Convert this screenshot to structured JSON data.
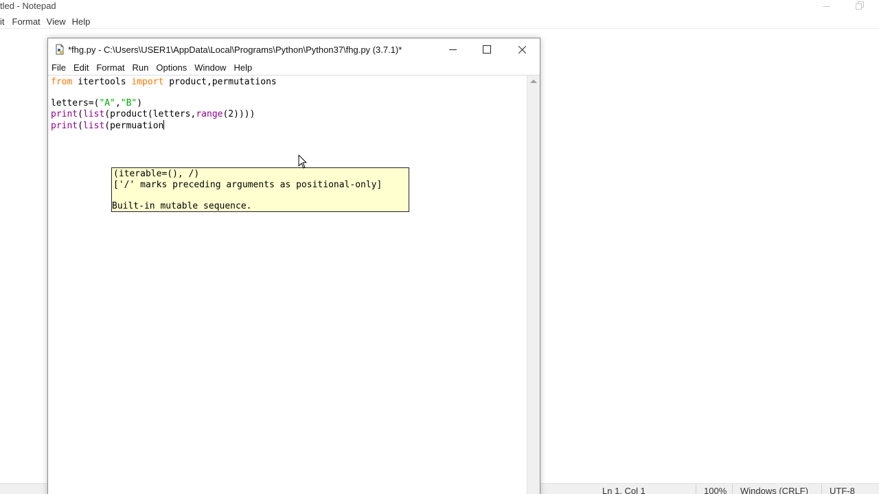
{
  "notepad": {
    "title": "tled - Notepad",
    "menu": {
      "edit": "it",
      "format": "Format",
      "view": "View",
      "help": "Help"
    },
    "status": {
      "position": "Ln 1, Col 1",
      "zoom": "100%",
      "line_endings": "Windows (CRLF)",
      "encoding": "UTF-8"
    }
  },
  "idle": {
    "title": "*fhg.py - C:\\Users\\USER1\\AppData\\Local\\Programs\\Python\\Python37\\fhg.py (3.7.1)*",
    "menu": {
      "file": "File",
      "edit": "Edit",
      "format": "Format",
      "run": "Run",
      "options": "Options",
      "window": "Window",
      "help": "Help"
    },
    "code": {
      "l1_from": "from",
      "l1_mod": " itertools ",
      "l1_import": "import",
      "l1_names": " product,permutations",
      "l3_a": "letters=(",
      "l3_s1": "\"A\"",
      "l3_comma": ",",
      "l3_s2": "\"B\"",
      "l3_close": ")",
      "l4_print": "print",
      "l4_p1": "(",
      "l4_list": "list",
      "l4_p2": "(product(letters,",
      "l4_range": "range",
      "l4_tail": "(2))))",
      "l5_print": "print",
      "l5_p1": "(",
      "l5_list": "list",
      "l5_tail": "(permuation"
    },
    "calltip": {
      "line1": "(iterable=(), /)",
      "line2": "['/' marks preceding arguments as positional-only]",
      "line3": "",
      "line4": "Built-in mutable sequence."
    }
  },
  "colors": {
    "keyword": "#ff7700",
    "builtin": "#900090",
    "string": "#00aa00",
    "calltip_bg": "#ffffd0"
  },
  "icons": [
    "python-file-icon",
    "minimize-icon",
    "maximize-icon",
    "close-icon",
    "scroll-up-arrow-icon",
    "mouse-pointer-icon"
  ]
}
